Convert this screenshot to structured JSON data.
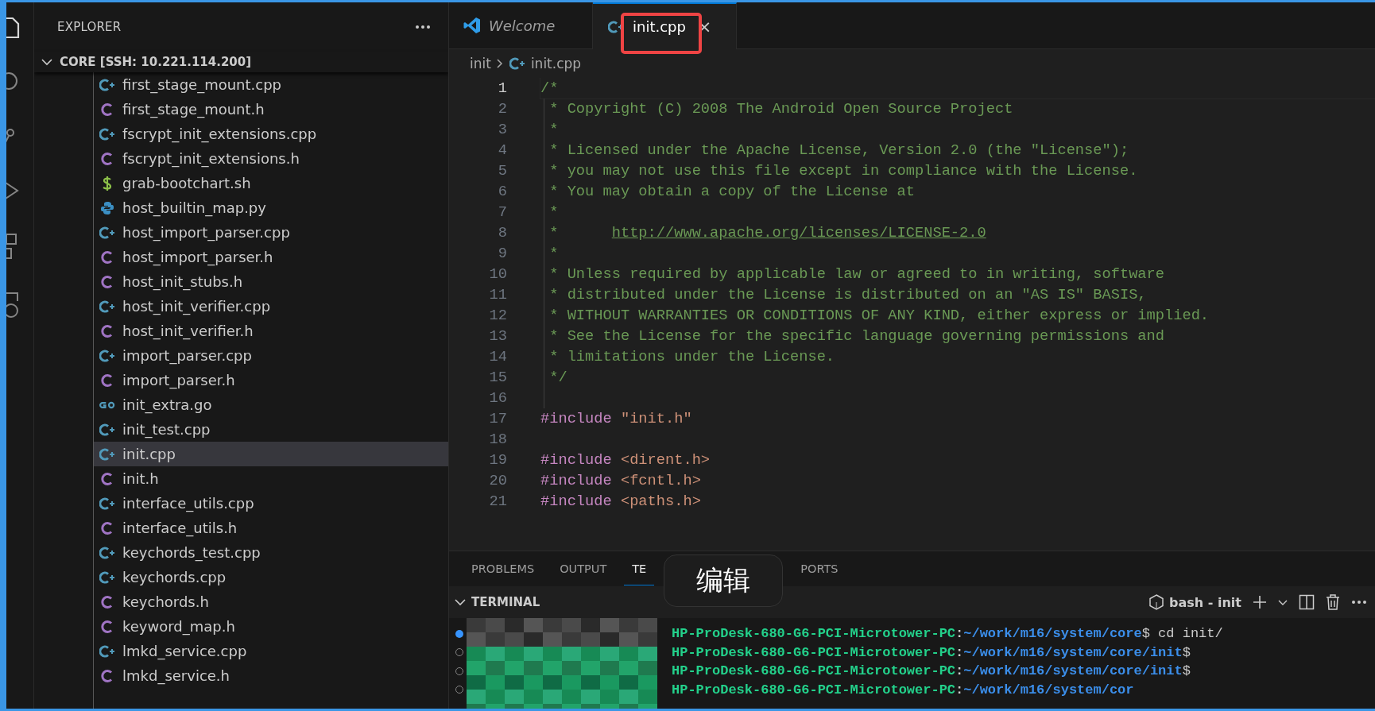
{
  "sidebar": {
    "title": "EXPLORER",
    "folder": {
      "label": "CORE [SSH: 10.221.114.200]",
      "expanded": true
    },
    "files": [
      {
        "name": "first_stage_mount.cpp",
        "kind": "cpp",
        "selected": false
      },
      {
        "name": "first_stage_mount.h",
        "kind": "h",
        "selected": false
      },
      {
        "name": "fscrypt_init_extensions.cpp",
        "kind": "cpp",
        "selected": false
      },
      {
        "name": "fscrypt_init_extensions.h",
        "kind": "h",
        "selected": false
      },
      {
        "name": "grab-bootchart.sh",
        "kind": "sh",
        "selected": false
      },
      {
        "name": "host_builtin_map.py",
        "kind": "py",
        "selected": false
      },
      {
        "name": "host_import_parser.cpp",
        "kind": "cpp",
        "selected": false
      },
      {
        "name": "host_import_parser.h",
        "kind": "h",
        "selected": false
      },
      {
        "name": "host_init_stubs.h",
        "kind": "h",
        "selected": false
      },
      {
        "name": "host_init_verifier.cpp",
        "kind": "cpp",
        "selected": false
      },
      {
        "name": "host_init_verifier.h",
        "kind": "h",
        "selected": false
      },
      {
        "name": "import_parser.cpp",
        "kind": "cpp",
        "selected": false
      },
      {
        "name": "import_parser.h",
        "kind": "h",
        "selected": false
      },
      {
        "name": "init_extra.go",
        "kind": "go",
        "selected": false
      },
      {
        "name": "init_test.cpp",
        "kind": "cpp",
        "selected": false
      },
      {
        "name": "init.cpp",
        "kind": "cpp",
        "selected": true
      },
      {
        "name": "init.h",
        "kind": "h",
        "selected": false
      },
      {
        "name": "interface_utils.cpp",
        "kind": "cpp",
        "selected": false
      },
      {
        "name": "interface_utils.h",
        "kind": "h",
        "selected": false
      },
      {
        "name": "keychords_test.cpp",
        "kind": "cpp",
        "selected": false
      },
      {
        "name": "keychords.cpp",
        "kind": "cpp",
        "selected": false
      },
      {
        "name": "keychords.h",
        "kind": "h",
        "selected": false
      },
      {
        "name": "keyword_map.h",
        "kind": "h",
        "selected": false
      },
      {
        "name": "lmkd_service.cpp",
        "kind": "cpp",
        "selected": false
      },
      {
        "name": "lmkd_service.h",
        "kind": "h",
        "selected": false
      }
    ]
  },
  "editor": {
    "tabs": [
      {
        "label": "Welcome",
        "kind": "welcome",
        "selected": false,
        "preview": true
      },
      {
        "label": "init.cpp",
        "kind": "cpp",
        "selected": true,
        "preview": false,
        "close": "×"
      }
    ],
    "breadcrumb": [
      {
        "label": "init",
        "kind": "folder"
      },
      {
        "label": "init.cpp",
        "kind": "cpp"
      }
    ],
    "lines": [
      {
        "number": "1",
        "current": true,
        "tokens": [
          {
            "kind": "comment",
            "text": "/*"
          }
        ]
      },
      {
        "number": "2",
        "current": false,
        "tokens": [
          {
            "kind": "comment",
            "text": " * Copyright (C) 2008 The Android Open Source Project"
          }
        ]
      },
      {
        "number": "3",
        "current": false,
        "tokens": [
          {
            "kind": "comment",
            "text": " *"
          }
        ]
      },
      {
        "number": "4",
        "current": false,
        "tokens": [
          {
            "kind": "comment",
            "text": " * Licensed under the Apache License, Version 2.0 (the \"License\");"
          }
        ]
      },
      {
        "number": "5",
        "current": false,
        "tokens": [
          {
            "kind": "comment",
            "text": " * you may not use this file except in compliance with the License."
          }
        ]
      },
      {
        "number": "6",
        "current": false,
        "tokens": [
          {
            "kind": "comment",
            "text": " * You may obtain a copy of the License at"
          }
        ]
      },
      {
        "number": "7",
        "current": false,
        "tokens": [
          {
            "kind": "comment",
            "text": " *"
          }
        ]
      },
      {
        "number": "8",
        "current": false,
        "tokens": [
          {
            "kind": "comment",
            "text": " *      "
          },
          {
            "kind": "link",
            "text": "http://www.apache.org/licenses/LICENSE-2.0"
          }
        ]
      },
      {
        "number": "9",
        "current": false,
        "tokens": [
          {
            "kind": "comment",
            "text": " *"
          }
        ]
      },
      {
        "number": "10",
        "current": false,
        "tokens": [
          {
            "kind": "comment",
            "text": " * Unless required by applicable law or agreed to in writing, software"
          }
        ]
      },
      {
        "number": "11",
        "current": false,
        "tokens": [
          {
            "kind": "comment",
            "text": " * distributed under the License is distributed on an \"AS IS\" BASIS,"
          }
        ]
      },
      {
        "number": "12",
        "current": false,
        "tokens": [
          {
            "kind": "comment",
            "text": " * WITHOUT WARRANTIES OR CONDITIONS OF ANY KIND, either express or implied."
          }
        ]
      },
      {
        "number": "13",
        "current": false,
        "tokens": [
          {
            "kind": "comment",
            "text": " * See the License for the specific language governing permissions and"
          }
        ]
      },
      {
        "number": "14",
        "current": false,
        "tokens": [
          {
            "kind": "comment",
            "text": " * limitations under the License."
          }
        ]
      },
      {
        "number": "15",
        "current": false,
        "tokens": [
          {
            "kind": "comment",
            "text": " */"
          }
        ]
      },
      {
        "number": "16",
        "current": false
      },
      {
        "number": "17",
        "current": false,
        "tokens": [
          {
            "kind": "directive",
            "text": "#include"
          },
          {
            "kind": "string",
            "text": " \"init.h\""
          }
        ]
      },
      {
        "number": "18",
        "current": false
      },
      {
        "number": "19",
        "current": false,
        "tokens": [
          {
            "kind": "directive",
            "text": "#include"
          },
          {
            "kind": "string",
            "text": " <dirent.h>"
          }
        ]
      },
      {
        "number": "20",
        "current": false,
        "tokens": [
          {
            "kind": "directive",
            "text": "#include"
          },
          {
            "kind": "string",
            "text": " <fcntl.h>"
          }
        ]
      },
      {
        "number": "21",
        "current": false,
        "tokens": [
          {
            "kind": "directive",
            "text": "#include"
          },
          {
            "kind": "string",
            "text": " <paths.h>"
          }
        ]
      }
    ]
  },
  "panel": {
    "tabs": [
      {
        "label": "PROBLEMS",
        "selected": false
      },
      {
        "label": "OUTPUT",
        "selected": false
      },
      {
        "label": "TE",
        "selected": true
      },
      {
        "label": "PORTS",
        "selected": false
      }
    ],
    "terminal": {
      "title": "TERMINAL",
      "expanded": true,
      "shell": "bash - init",
      "lines": [
        {
          "decorated": true,
          "host": "HP-ProDesk-680-G6-PCI-Microtower-PC",
          "sep": ":",
          "path": "~/work/m16/system/core",
          "command": "$ cd init/"
        },
        {
          "decorated": false,
          "host": "HP-ProDesk-680-G6-PCI-Microtower-PC",
          "sep": ":",
          "path": "~/work/m16/system/core/init",
          "command": "$"
        },
        {
          "decorated": false,
          "host": "HP-ProDesk-680-G6-PCI-Microtower-PC",
          "sep": ":",
          "path": "~/work/m16/system/core/init",
          "command": "$"
        },
        {
          "decorated": false,
          "host": "HP-ProDesk-680-G6-PCI-Microtower-PC",
          "sep": ":",
          "path": "~/work/m16/system/cor"
        }
      ]
    }
  },
  "toast": {
    "text": "编辑"
  }
}
